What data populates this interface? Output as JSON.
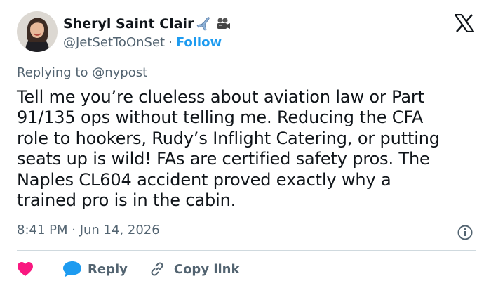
{
  "author": {
    "name": "Sheryl Saint Clair",
    "emojis": [
      "airplane-emoji",
      "movie-camera-emoji"
    ],
    "handle": "@JetSetToOnSet",
    "separator": "·",
    "follow_label": "Follow"
  },
  "brand": {
    "logo": "x-logo-icon"
  },
  "reply_context": {
    "prefix": "Replying to",
    "mention": "@nypost"
  },
  "tweet": {
    "lines": [
      "Tell me you’re clueless about aviation law or Part",
      "91/135 ops without telling me. Reducing the CFA",
      "role to hookers, Rudy’s Inflight Catering, or putting",
      "seats up is wild! FAs are certified safety pros. The",
      "Naples CL604 accident proved exactly why a",
      "trained pro is in the cabin."
    ]
  },
  "meta": {
    "timestamp": "8:41 PM · Jun 14, 2026",
    "info_icon": "info-icon"
  },
  "actions": {
    "like_icon": "heart-icon",
    "reply_label": "Reply",
    "copy_label": "Copy link"
  },
  "colors": {
    "text": "#0f1419",
    "secondary": "#536471",
    "accent": "#1d9bf0",
    "like": "#f91880",
    "divider": "#cfd9de"
  }
}
